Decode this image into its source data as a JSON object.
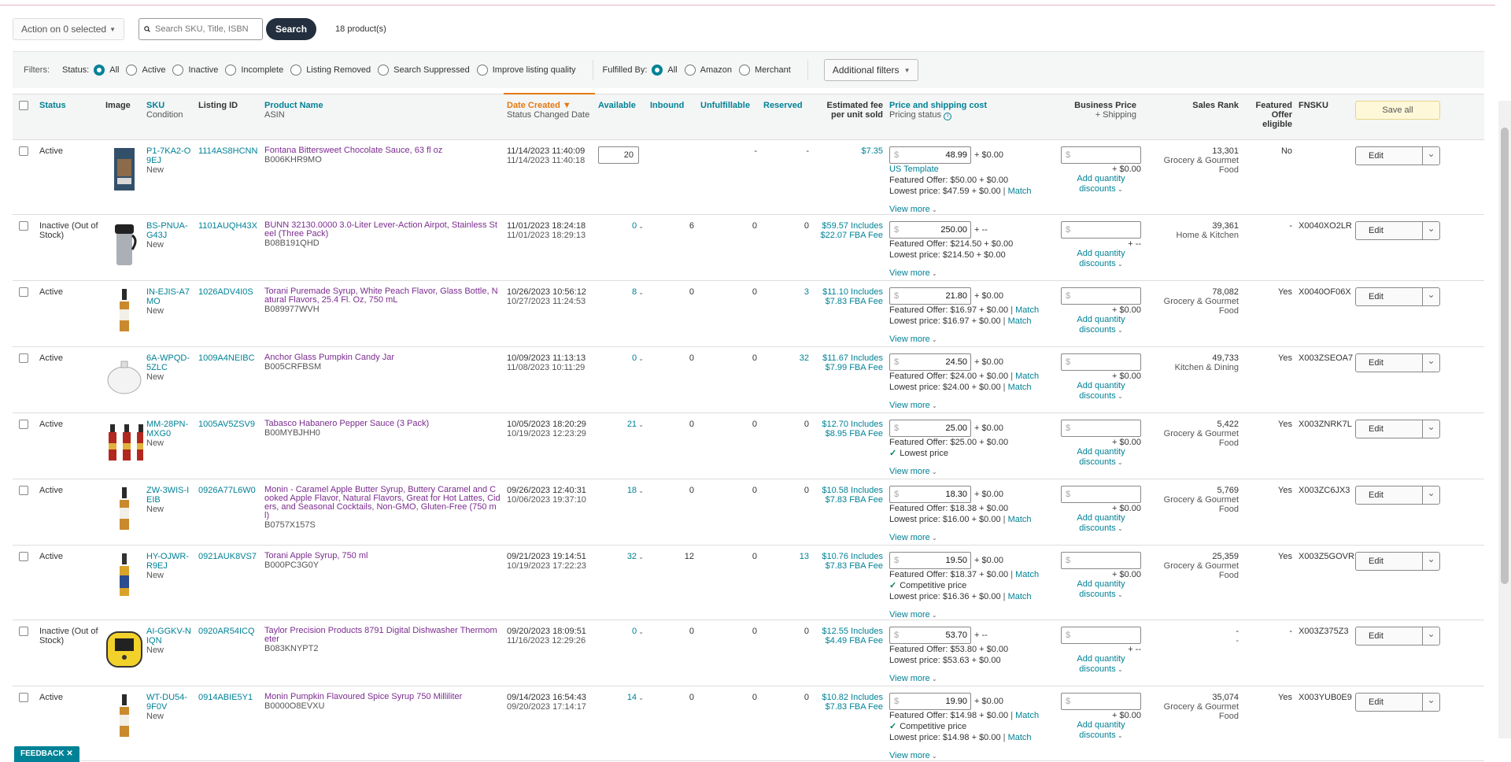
{
  "toolbar": {
    "action_label": "Action on 0 selected",
    "search_placeholder": "Search SKU, Title, ISBN",
    "search_button": "Search",
    "product_count": "18 product(s)"
  },
  "filters": {
    "label": "Filters:",
    "status_label": "Status:",
    "status_options": [
      "All",
      "Active",
      "Inactive",
      "Incomplete",
      "Listing Removed",
      "Search Suppressed",
      "Improve listing quality"
    ],
    "fulfilled_label": "Fulfilled By:",
    "fulfilled_options": [
      "All",
      "Amazon",
      "Merchant"
    ],
    "additional_filters": "Additional filters"
  },
  "columns": {
    "status": "Status",
    "image": "Image",
    "sku": "SKU",
    "sku_sub": "Condition",
    "listing_id": "Listing ID",
    "product_name": "Product Name",
    "product_name_sub": "ASIN",
    "date_created": "Date Created",
    "date_created_sub": "Status Changed Date",
    "available": "Available",
    "inbound": "Inbound",
    "unfulfillable": "Unfulfillable",
    "reserved": "Reserved",
    "est_fee": "Estimated fee per unit sold",
    "price": "Price and shipping cost",
    "price_sub": "Pricing status",
    "business_price": "Business Price",
    "business_price_sub": "+ Shipping",
    "sales_rank": "Sales Rank",
    "featured": "Featured Offer eligible",
    "fnsku": "FNSKU",
    "save_all": "Save all"
  },
  "labels": {
    "view_more": "View more",
    "add_qty": "Add quantity discounts",
    "edit": "Edit",
    "match": "Match",
    "currency": "$",
    "feedback": "FEEDBACK"
  },
  "rows": [
    {
      "status": "Active",
      "sku": "P1-7KA2-O9EJ",
      "condition": "New",
      "listing_id": "1114AS8HCNN",
      "name": "Fontana Bittersweet Chocolate Sauce, 63 fl oz",
      "asin": "B006KHR9MO",
      "created": "11/14/2023 11:40:09",
      "changed": "11/14/2023 11:40:18",
      "available": "20",
      "available_input": true,
      "inbound": "",
      "unfulfillable": "-",
      "reserved": "-",
      "fee1": "$7.35",
      "fee2": "",
      "price": "48.99",
      "ship": "+ $0.00",
      "price_lines": [
        {
          "t": "US Template",
          "m": false,
          "c": false
        },
        {
          "t": "Featured Offer: $50.00 + $0.00",
          "m": false,
          "c": false
        },
        {
          "t": "Lowest price: $47.59 + $0.00",
          "m": true,
          "c": false
        }
      ],
      "bp_ship": "+ $0.00",
      "rank": "13,301",
      "category": "Grocery & Gourmet Food",
      "featured": "No",
      "fnsku": "",
      "img": "box"
    },
    {
      "status": "Inactive (Out of Stock)",
      "sku": "BS-PNUA-G43J",
      "condition": "New",
      "listing_id": "1101AUQH43X",
      "name": "BUNN 32130.0000 3.0-Liter Lever-Action Airpot, Stainless Steel (Three Pack)",
      "asin": "B08B191QHD",
      "created": "11/01/2023 18:24:18",
      "changed": "11/01/2023 18:29:13",
      "available": "0",
      "available_input": false,
      "inbound": "6",
      "unfulfillable": "0",
      "reserved": "0",
      "fee1": "$59.57 Includes",
      "fee2": "$22.07 FBA Fee",
      "price": "250.00",
      "ship": "+ --",
      "price_lines": [
        {
          "t": "Featured Offer: $214.50 + $0.00",
          "m": false,
          "c": false
        },
        {
          "t": "Lowest price: $214.50 + $0.00",
          "m": false,
          "c": false
        }
      ],
      "bp_ship": "+ --",
      "rank": "39,361",
      "category": "Home & Kitchen",
      "featured": "-",
      "fnsku": "X0040XO2LR",
      "img": "airpot"
    },
    {
      "status": "Active",
      "sku": "IN-EJIS-A7MO",
      "condition": "New",
      "listing_id": "1026ADV4I0S",
      "name": "Torani Puremade Syrup, White Peach Flavor, Glass Bottle, Natural Flavors, 25.4 Fl. Oz, 750 mL",
      "asin": "B089977WVH",
      "created": "10/26/2023 10:56:12",
      "changed": "10/27/2023 11:24:53",
      "available": "8",
      "available_input": false,
      "inbound": "0",
      "unfulfillable": "0",
      "reserved": "3",
      "fee1": "$11.10 Includes",
      "fee2": "$7.83 FBA Fee",
      "price": "21.80",
      "ship": "+ $0.00",
      "price_lines": [
        {
          "t": "Featured Offer: $16.97 + $0.00",
          "m": true,
          "c": false
        },
        {
          "t": "Lowest price: $16.97 + $0.00",
          "m": true,
          "c": false
        }
      ],
      "bp_ship": "+ $0.00",
      "rank": "78,082",
      "category": "Grocery & Gourmet Food",
      "featured": "Yes",
      "fnsku": "X0040OF06X",
      "img": "bottle"
    },
    {
      "status": "Active",
      "sku": "6A-WPQD-5ZLC",
      "condition": "New",
      "listing_id": "1009A4NEIBC",
      "name": "Anchor Glass Pumpkin Candy Jar",
      "asin": "B005CRFBSM",
      "created": "10/09/2023 11:13:13",
      "changed": "11/08/2023 10:11:29",
      "available": "0",
      "available_input": false,
      "inbound": "0",
      "unfulfillable": "0",
      "reserved": "32",
      "fee1": "$11.67 Includes",
      "fee2": "$7.99 FBA Fee",
      "price": "24.50",
      "ship": "+ $0.00",
      "price_lines": [
        {
          "t": "Featured Offer: $24.00 + $0.00",
          "m": true,
          "c": false
        },
        {
          "t": "Lowest price: $24.00 + $0.00",
          "m": true,
          "c": false
        }
      ],
      "bp_ship": "+ $0.00",
      "rank": "49,733",
      "category": "Kitchen & Dining",
      "featured": "Yes",
      "fnsku": "X003ZSEOA7",
      "img": "jar"
    },
    {
      "status": "Active",
      "sku": "MM-28PN-MXG0",
      "condition": "New",
      "listing_id": "1005AV5ZSV9",
      "name": "Tabasco Habanero Pepper Sauce (3 Pack)",
      "asin": "B00MYBJHH0",
      "created": "10/05/2023 18:20:29",
      "changed": "10/19/2023 12:23:29",
      "available": "21",
      "available_input": false,
      "inbound": "0",
      "unfulfillable": "0",
      "reserved": "0",
      "fee1": "$12.70 Includes",
      "fee2": "$8.95 FBA Fee",
      "price": "25.00",
      "ship": "+ $0.00",
      "price_lines": [
        {
          "t": "Featured Offer: $25.00 + $0.00",
          "m": false,
          "c": false
        },
        {
          "t": "Lowest price",
          "m": false,
          "c": true
        }
      ],
      "bp_ship": "+ $0.00",
      "rank": "5,422",
      "category": "Grocery & Gourmet Food",
      "featured": "Yes",
      "fnsku": "X003ZNRK7L",
      "img": "three"
    },
    {
      "status": "Active",
      "sku": "ZW-3WIS-IEIB",
      "condition": "New",
      "listing_id": "0926A77L6W0",
      "name": "Monin - Caramel Apple Butter Syrup, Buttery Caramel and Cooked Apple Flavor, Natural Flavors, Great for Hot Lattes, Ciders, and Seasonal Cocktails, Non-GMO, Gluten-Free (750 ml)",
      "asin": "B0757X157S",
      "created": "09/26/2023 12:40:31",
      "changed": "10/06/2023 19:37:10",
      "available": "18",
      "available_input": false,
      "inbound": "0",
      "unfulfillable": "0",
      "reserved": "0",
      "fee1": "$10.58 Includes",
      "fee2": "$7.83 FBA Fee",
      "price": "18.30",
      "ship": "+ $0.00",
      "price_lines": [
        {
          "t": "Featured Offer: $18.38 + $0.00",
          "m": false,
          "c": false
        },
        {
          "t": "Lowest price: $16.00 + $0.00",
          "m": true,
          "c": false
        }
      ],
      "bp_ship": "+ $0.00",
      "rank": "5,769",
      "category": "Grocery & Gourmet Food",
      "featured": "Yes",
      "fnsku": "X003ZC6JX3",
      "img": "bottle"
    },
    {
      "status": "Active",
      "sku": "HY-OJWR-R9EJ",
      "condition": "New",
      "listing_id": "0921AUK8VS7",
      "name": "Torani Apple Syrup, 750 ml",
      "asin": "B000PC3G0Y",
      "created": "09/21/2023 19:14:51",
      "changed": "10/19/2023 17:22:23",
      "available": "32",
      "available_input": false,
      "inbound": "12",
      "unfulfillable": "0",
      "reserved": "13",
      "fee1": "$10.76 Includes",
      "fee2": "$7.83 FBA Fee",
      "price": "19.50",
      "ship": "+ $0.00",
      "price_lines": [
        {
          "t": "Featured Offer: $18.37 + $0.00",
          "m": true,
          "c": false
        },
        {
          "t": "Competitive price",
          "m": false,
          "c": true
        },
        {
          "t": "Lowest price: $16.36 + $0.00",
          "m": true,
          "c": false
        }
      ],
      "bp_ship": "+ $0.00",
      "rank": "25,359",
      "category": "Grocery & Gourmet Food",
      "featured": "Yes",
      "fnsku": "X003Z5GOVR",
      "img": "bottle2"
    },
    {
      "status": "Inactive (Out of Stock)",
      "sku": "AI-GGKV-NIQN",
      "condition": "New",
      "listing_id": "0920AR54ICQ",
      "name": "Taylor Precision Products 8791 Digital Dishwasher Thermometer",
      "asin": "B083KNYPT2",
      "created": "09/20/2023 18:09:51",
      "changed": "11/16/2023 12:29:26",
      "available": "0",
      "available_input": false,
      "inbound": "0",
      "unfulfillable": "0",
      "reserved": "0",
      "fee1": "$12.55 Includes",
      "fee2": "$4.49 FBA Fee",
      "price": "53.70",
      "ship": "+ --",
      "price_lines": [
        {
          "t": "Featured Offer: $53.80 + $0.00",
          "m": false,
          "c": false
        },
        {
          "t": "Lowest price: $53.63 + $0.00",
          "m": false,
          "c": false
        }
      ],
      "bp_ship": "+ --",
      "rank": "-",
      "category": "-",
      "featured": "-",
      "fnsku": "X003Z375Z3",
      "img": "thermo"
    },
    {
      "status": "Active",
      "sku": "WT-DU54-9F0V",
      "condition": "New",
      "listing_id": "0914ABIE5Y1",
      "name": "Monin Pumpkin Flavoured Spice Syrup 750 Milliliter",
      "asin": "B0000O8EVXU",
      "created": "09/14/2023 16:54:43",
      "changed": "09/20/2023 17:14:17",
      "available": "14",
      "available_input": false,
      "inbound": "0",
      "unfulfillable": "0",
      "reserved": "0",
      "fee1": "$10.82 Includes",
      "fee2": "$7.83 FBA Fee",
      "price": "19.90",
      "ship": "+ $0.00",
      "price_lines": [
        {
          "t": "Featured Offer: $14.98 + $0.00",
          "m": true,
          "c": false
        },
        {
          "t": "Competitive price",
          "m": false,
          "c": true
        },
        {
          "t": "Lowest price: $14.98 + $0.00",
          "m": true,
          "c": false
        }
      ],
      "bp_ship": "+ $0.00",
      "rank": "35,074",
      "category": "Grocery & Gourmet Food",
      "featured": "Yes",
      "fnsku": "X003YUB0E9",
      "img": "bottle"
    }
  ]
}
